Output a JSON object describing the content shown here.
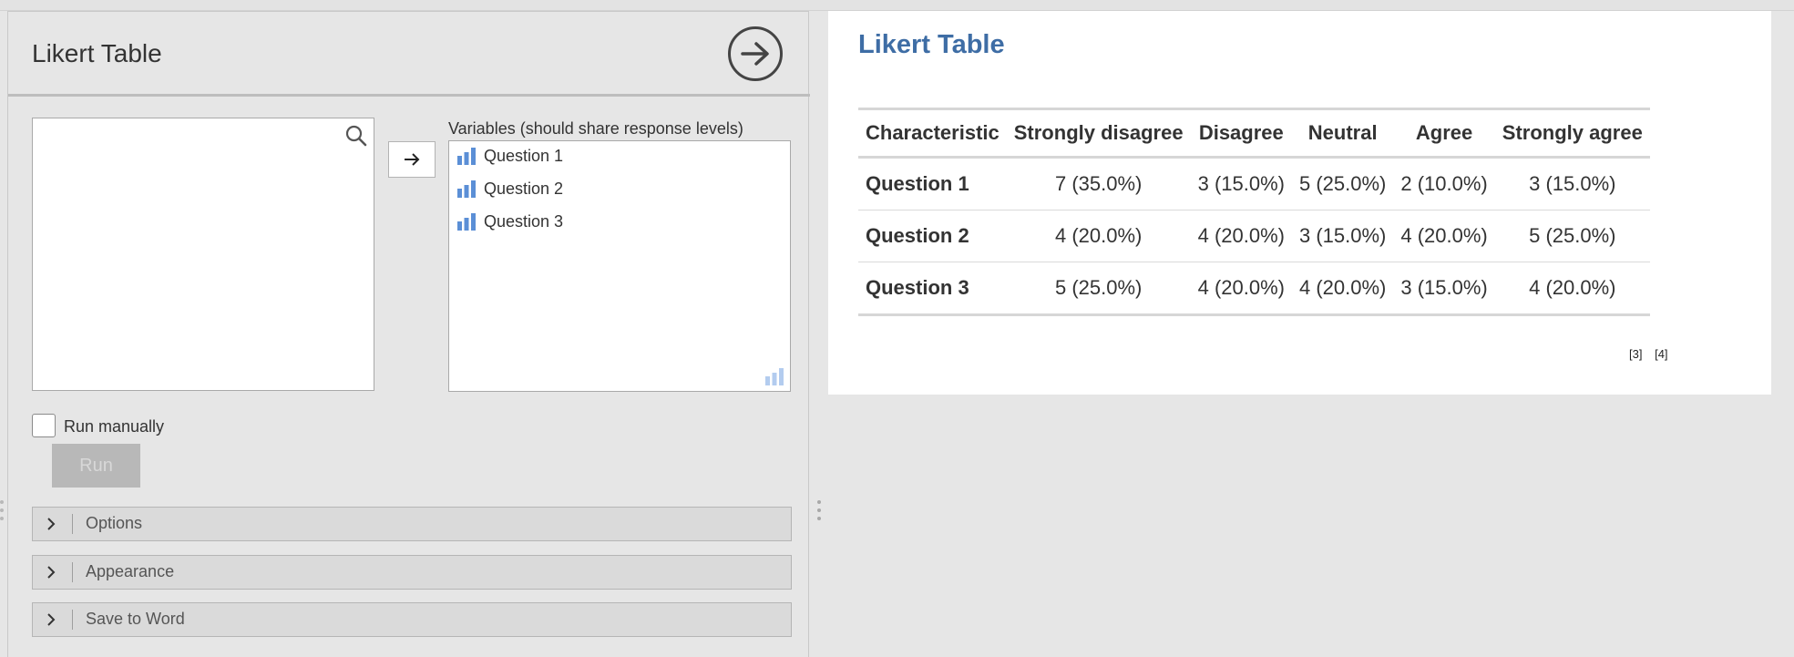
{
  "options_panel": {
    "title": "Likert Table",
    "variables_label": "Variables (should share response levels)",
    "variables": [
      "Question 1",
      "Question 2",
      "Question 3"
    ],
    "run_manually_label": "Run manually",
    "run_manually_checked": false,
    "run_label": "Run",
    "sections": [
      "Options",
      "Appearance",
      "Save to Word"
    ]
  },
  "results": {
    "title": "Likert Table",
    "table": {
      "columns": [
        "Characteristic",
        "Strongly disagree",
        "Disagree",
        "Neutral",
        "Agree",
        "Strongly agree"
      ],
      "rows": [
        [
          "Question 1",
          "7 (35.0%)",
          "3 (15.0%)",
          "5 (25.0%)",
          "2 (10.0%)",
          "3 (15.0%)"
        ],
        [
          "Question 2",
          "4 (20.0%)",
          "4 (20.0%)",
          "3 (15.0%)",
          "4 (20.0%)",
          "5 (25.0%)"
        ],
        [
          "Question 3",
          "5 (25.0%)",
          "4 (20.0%)",
          "4 (20.0%)",
          "3 (15.0%)",
          "4 (20.0%)"
        ]
      ]
    },
    "references": [
      "[3]",
      "[4]"
    ]
  },
  "colors": {
    "results_title": "#3e6da5",
    "variable_icon": "#5b8fd6",
    "panel_bg": "#e6e6e6"
  },
  "icons": {
    "go": "arrow-circle-right-icon",
    "search": "search-icon",
    "transfer": "arrow-right-icon",
    "variable": "ordinal-bar-icon",
    "section": "chevron-right-icon"
  }
}
